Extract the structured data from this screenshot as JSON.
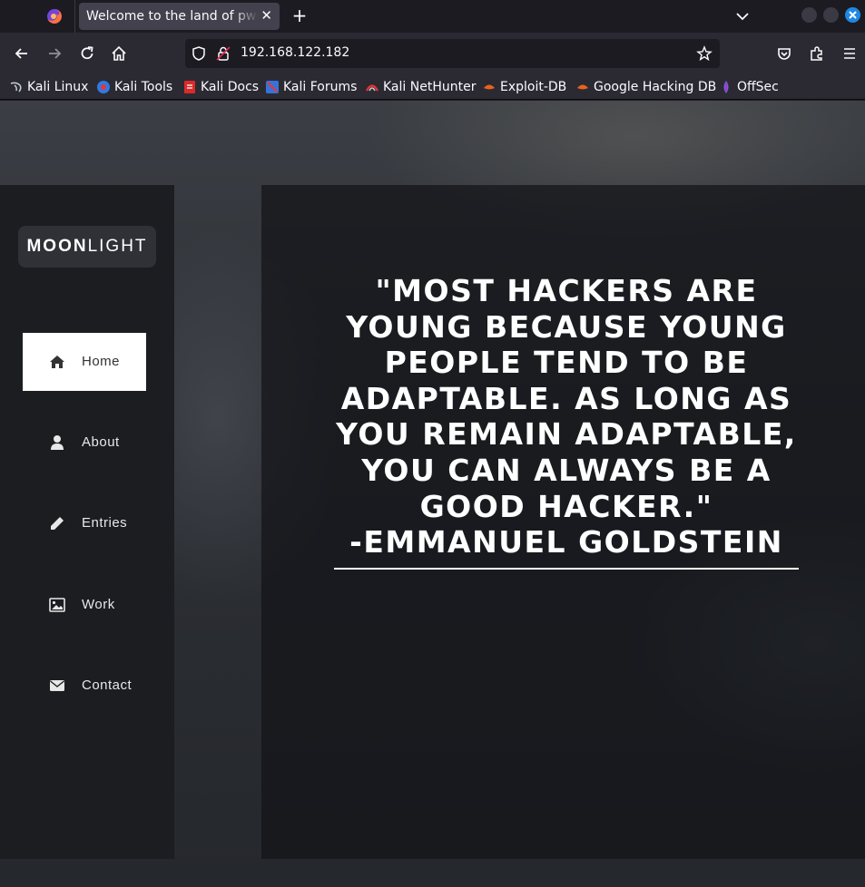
{
  "browser": {
    "tab_title": "Welcome to the land of pwnland",
    "url": "192.168.122.182",
    "bookmarks": [
      {
        "label": "Kali Linux",
        "icon": "kali-dragon-icon"
      },
      {
        "label": "Kali Tools",
        "icon": "kali-tools-icon"
      },
      {
        "label": "Kali Docs",
        "icon": "kali-docs-icon"
      },
      {
        "label": "Kali Forums",
        "icon": "kali-forums-icon"
      },
      {
        "label": "Kali NetHunter",
        "icon": "kali-nethunter-icon"
      },
      {
        "label": "Exploit-DB",
        "icon": "exploit-db-icon"
      },
      {
        "label": "Google Hacking DB",
        "icon": "ghdb-icon"
      },
      {
        "label": "OffSec",
        "icon": "offsec-icon"
      }
    ]
  },
  "site": {
    "logo_bold": "MOON",
    "logo_light": "LIGHT",
    "menu": [
      {
        "label": "Home",
        "icon": "home-icon",
        "active": true
      },
      {
        "label": "About",
        "icon": "user-icon",
        "active": false
      },
      {
        "label": "Entries",
        "icon": "pencil-icon",
        "active": false
      },
      {
        "label": "Work",
        "icon": "image-icon",
        "active": false
      },
      {
        "label": "Contact",
        "icon": "envelope-icon",
        "active": false
      }
    ],
    "quote": "\"MOST HACKERS ARE YOUNG BECAUSE YOUNG PEOPLE TEND TO BE ADAPTABLE. AS LONG AS YOU REMAIN ADAPTABLE, YOU CAN ALWAYS BE A GOOD HACKER.\"",
    "quote_author": "-EMMANUEL GOLDSTEIN"
  }
}
